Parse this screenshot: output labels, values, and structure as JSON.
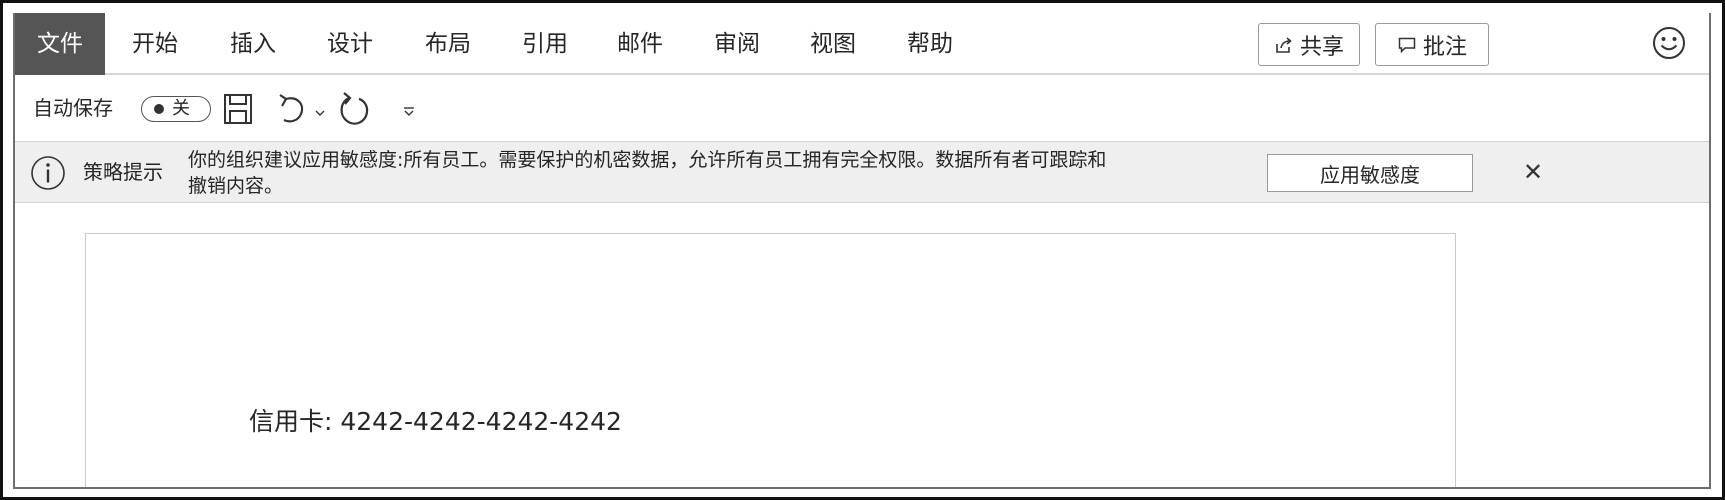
{
  "menubar": {
    "tabs": [
      "文件",
      "开始",
      "插入",
      "设计",
      "布局",
      "引用",
      "邮件",
      "审阅",
      "视图",
      "帮助"
    ],
    "share_label": "共享",
    "comments_label": "批注",
    "share_icon": "share-icon",
    "comments_icon": "comment-icon",
    "feedback_icon": "smiley-icon"
  },
  "quick_access": {
    "autosave_label": "自动保存",
    "autosave_state": "关",
    "icons": [
      "save-icon",
      "undo-icon",
      "undo-dropdown-icon",
      "redo-icon",
      "customize-toolbar-icon"
    ]
  },
  "policy_tip": {
    "title": "策略提示",
    "message_line1": "你的组织建议应用敏感度:所有员工。需要保护的机密数据，允许所有员工拥有完全权限。数据所有者可跟踪和",
    "message_line2": "撤销内容。",
    "action_label": "应用敏感度",
    "close_label": "✕"
  },
  "document": {
    "body_text": "信用卡: 4242-4242-4242-4242"
  },
  "colors": {
    "active_tab_bg": "#555555",
    "policy_bar_bg": "#efefef"
  }
}
